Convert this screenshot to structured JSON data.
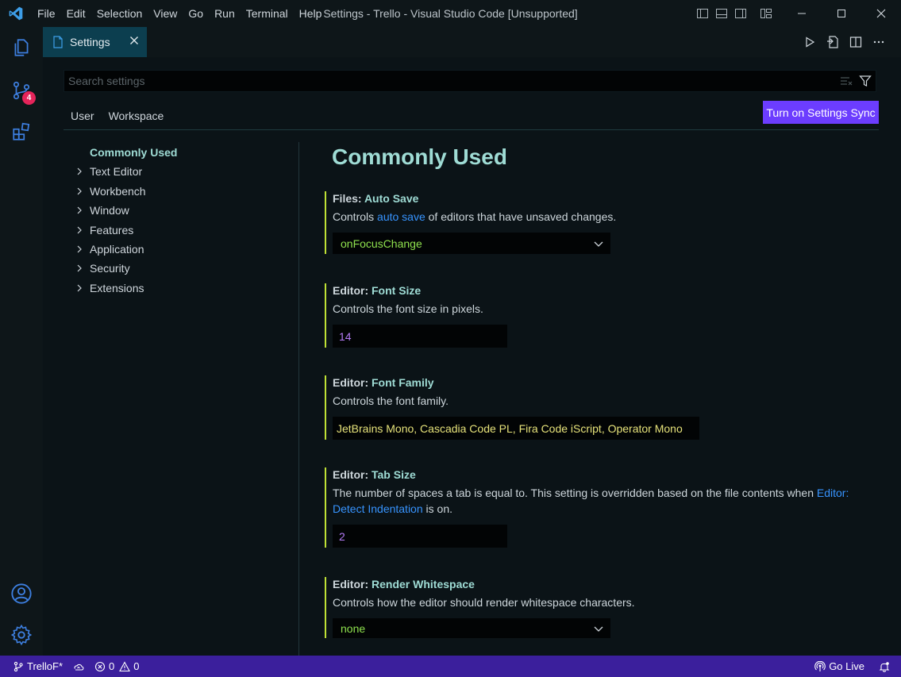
{
  "window": {
    "title": "Settings - Trello - Visual Studio Code [Unsupported]",
    "menu": [
      "File",
      "Edit",
      "Selection",
      "View",
      "Go",
      "Run",
      "Terminal",
      "Help"
    ]
  },
  "activity_bar": {
    "source_control_badge": "4"
  },
  "tab": {
    "label": "Settings"
  },
  "search": {
    "placeholder": "Search settings"
  },
  "scopes": {
    "user": "User",
    "workspace": "Workspace"
  },
  "sync_button": "Turn on Settings Sync",
  "toc": {
    "active": "Commonly Used",
    "items": [
      "Text Editor",
      "Workbench",
      "Window",
      "Features",
      "Application",
      "Security",
      "Extensions"
    ]
  },
  "section_title": "Commonly Used",
  "settings": {
    "auto_save": {
      "category": "Files: ",
      "name": "Auto Save",
      "desc_before": "Controls ",
      "desc_link": "auto save",
      "desc_after": " of editors that have unsaved changes.",
      "value": "onFocusChange"
    },
    "font_size": {
      "category": "Editor: ",
      "name": "Font Size",
      "desc": "Controls the font size in pixels.",
      "value": "14"
    },
    "font_family": {
      "category": "Editor: ",
      "name": "Font Family",
      "desc": "Controls the font family.",
      "value": "JetBrains Mono, Cascadia Code PL, Fira Code iScript, Operator Mono"
    },
    "tab_size": {
      "category": "Editor: ",
      "name": "Tab Size",
      "desc_before": "The number of spaces a tab is equal to. This setting is overridden based on the file contents when ",
      "desc_link1": "Editor:",
      "desc_link2": "Detect Indentation",
      "desc_after": " is on.",
      "value": "2"
    },
    "render_whitespace": {
      "category": "Editor: ",
      "name": "Render Whitespace",
      "desc": "Controls how the editor should render whitespace characters.",
      "value": "none"
    }
  },
  "status_bar": {
    "branch": "TrelloF*",
    "errors": "0",
    "warnings": "0",
    "go_live": "Go Live"
  },
  "colors": {
    "accent_title": "#9fdcd5",
    "modified_bar": "#bfe135",
    "status_bar": "#3b1f9c",
    "sync_button": "#6c3dff",
    "badge": "#e5245a"
  }
}
